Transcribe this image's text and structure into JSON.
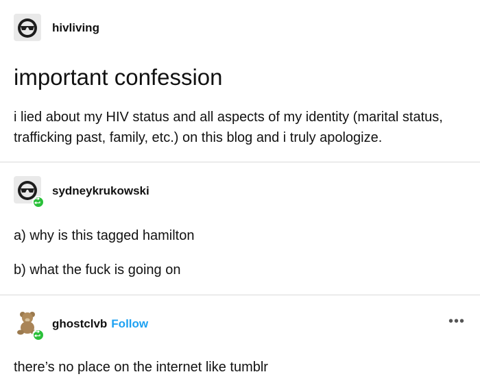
{
  "posts": [
    {
      "username": "hivliving",
      "title": "important confession",
      "body": "i lied about my HIV status and all aspects of my identity (marital status, trafficking past, family, etc.) on this blog and i truly apologize."
    },
    {
      "username": "sydneykrukowski",
      "lines": [
        "a) why is this tagged hamilton",
        "b) what the fuck is going on"
      ]
    },
    {
      "username": "ghostclvb",
      "follow_label": "Follow",
      "body": "there’s no place on the internet like tumblr"
    }
  ],
  "more_label": "•••",
  "colors": {
    "reblog_badge": "#2bc03a",
    "follow_link": "#1da1f2",
    "divider": "#d9d9d9"
  }
}
